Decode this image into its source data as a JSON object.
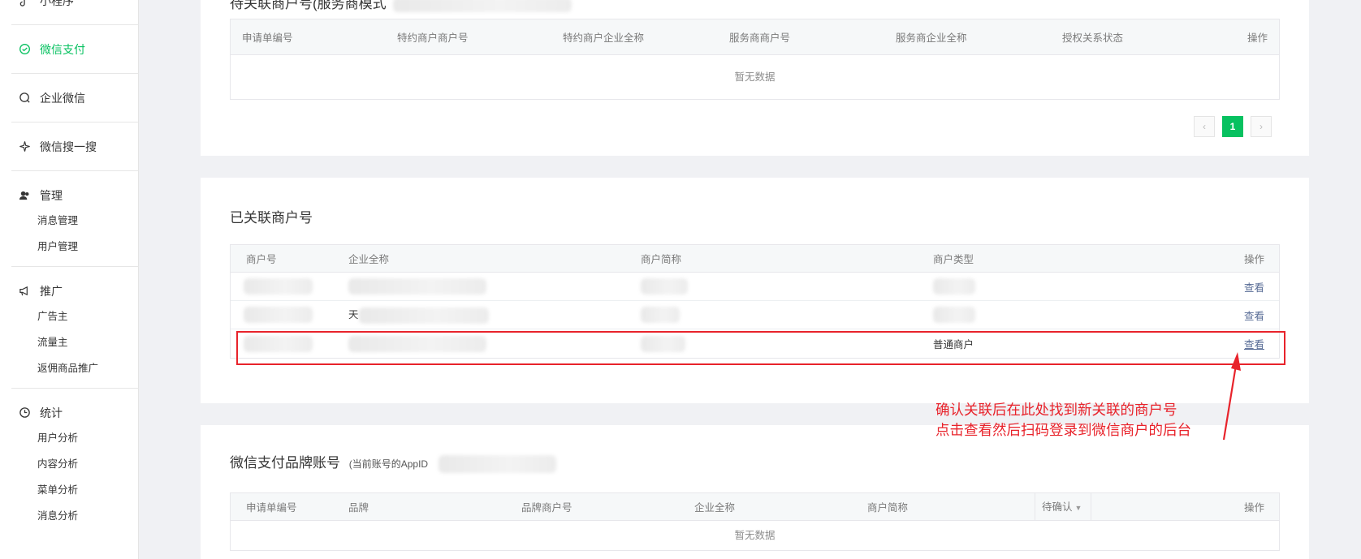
{
  "sidebar": {
    "mini_program": "小程序",
    "wechat_pay": "微信支付",
    "wecom": "企业微信",
    "search": "微信搜一搜",
    "manage": {
      "label": "管理",
      "items": [
        "消息管理",
        "用户管理"
      ]
    },
    "promote": {
      "label": "推广",
      "items": [
        "广告主",
        "流量主",
        "返佣商品推广"
      ]
    },
    "stats": {
      "label": "统计",
      "items": [
        "用户分析",
        "内容分析",
        "菜单分析",
        "消息分析"
      ]
    }
  },
  "pending": {
    "title": "待关联商户号(服务商模式",
    "headers": [
      "申请单编号",
      "特约商户商户号",
      "特约商户企业全称",
      "服务商商户号",
      "服务商企业全称",
      "授权关系状态",
      "操作"
    ],
    "empty_text": "暂无数据",
    "pager": {
      "prev": "‹",
      "current": "1",
      "next": "›"
    }
  },
  "linked": {
    "title": "已关联商户号",
    "headers": [
      "商户号",
      "企业全称",
      "商户简称",
      "商户类型",
      "操作"
    ],
    "rows": [
      {
        "prefix": "",
        "type": "",
        "action": "查看"
      },
      {
        "prefix": "天",
        "type": "",
        "action": "查看"
      },
      {
        "prefix": "",
        "type": "普通商户",
        "action": "查看"
      }
    ]
  },
  "brand": {
    "title": "微信支付品牌账号",
    "note": "(当前账号的AppID",
    "headers": [
      "申请单编号",
      "品牌",
      "品牌商户号",
      "企业全称",
      "商户简称",
      "待确认",
      "操作"
    ],
    "empty_text": "暂无数据"
  },
  "annotation": {
    "line1": "确认关联后在此处找到新关联的商户号",
    "line2": "点击查看然后扫码登录到微信商户的后台"
  },
  "colors": {
    "accent": "#07c160",
    "annotation": "#e8232b",
    "link": "#576b95"
  }
}
